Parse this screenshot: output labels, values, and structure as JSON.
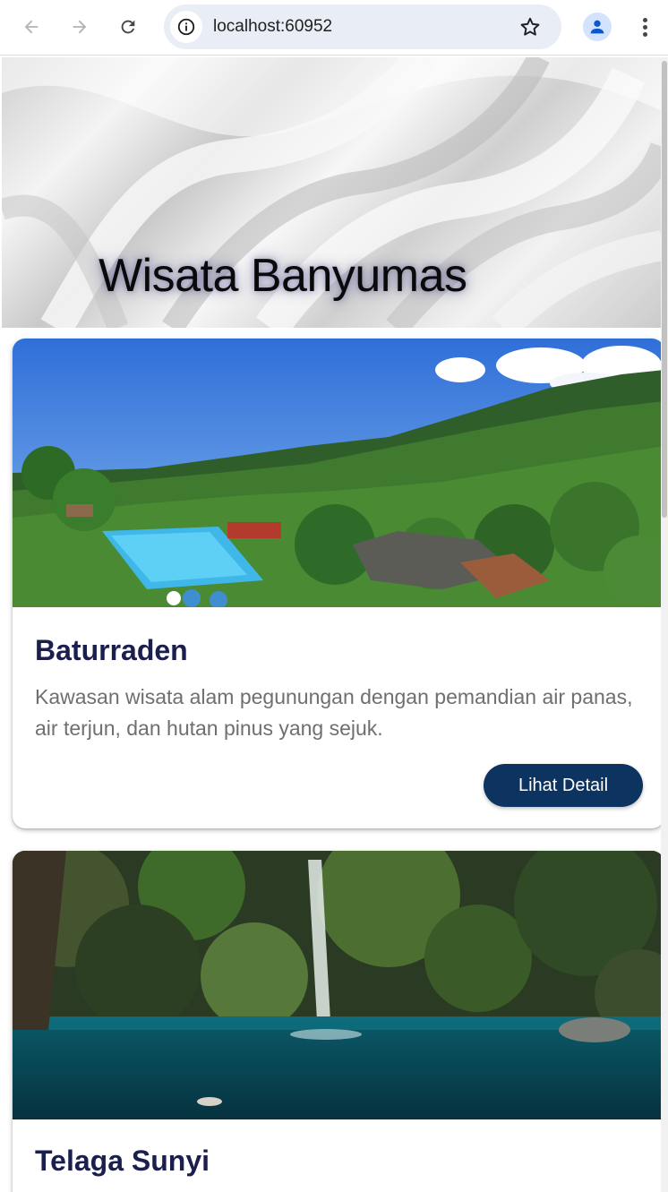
{
  "browser": {
    "url": "localhost:60952",
    "icons": [
      "back-arrow-icon",
      "forward-arrow-icon",
      "reload-icon",
      "site-info-icon",
      "bookmark-star-icon",
      "profile-icon",
      "more-menu-icon"
    ]
  },
  "page": {
    "header_title": "Wisata Banyumas",
    "destinations": [
      {
        "name": "Baturraden",
        "description": "Kawasan wisata alam pegunungan dengan pemandian air panas, air terjun, dan hutan pinus yang sejuk.",
        "button_label": "Lihat Detail"
      },
      {
        "name": "Telaga Sunyi"
      }
    ]
  },
  "colors": {
    "title_text": "#1a1f4e",
    "button_bg": "#0d3461",
    "description_text": "#6f6f6f"
  }
}
